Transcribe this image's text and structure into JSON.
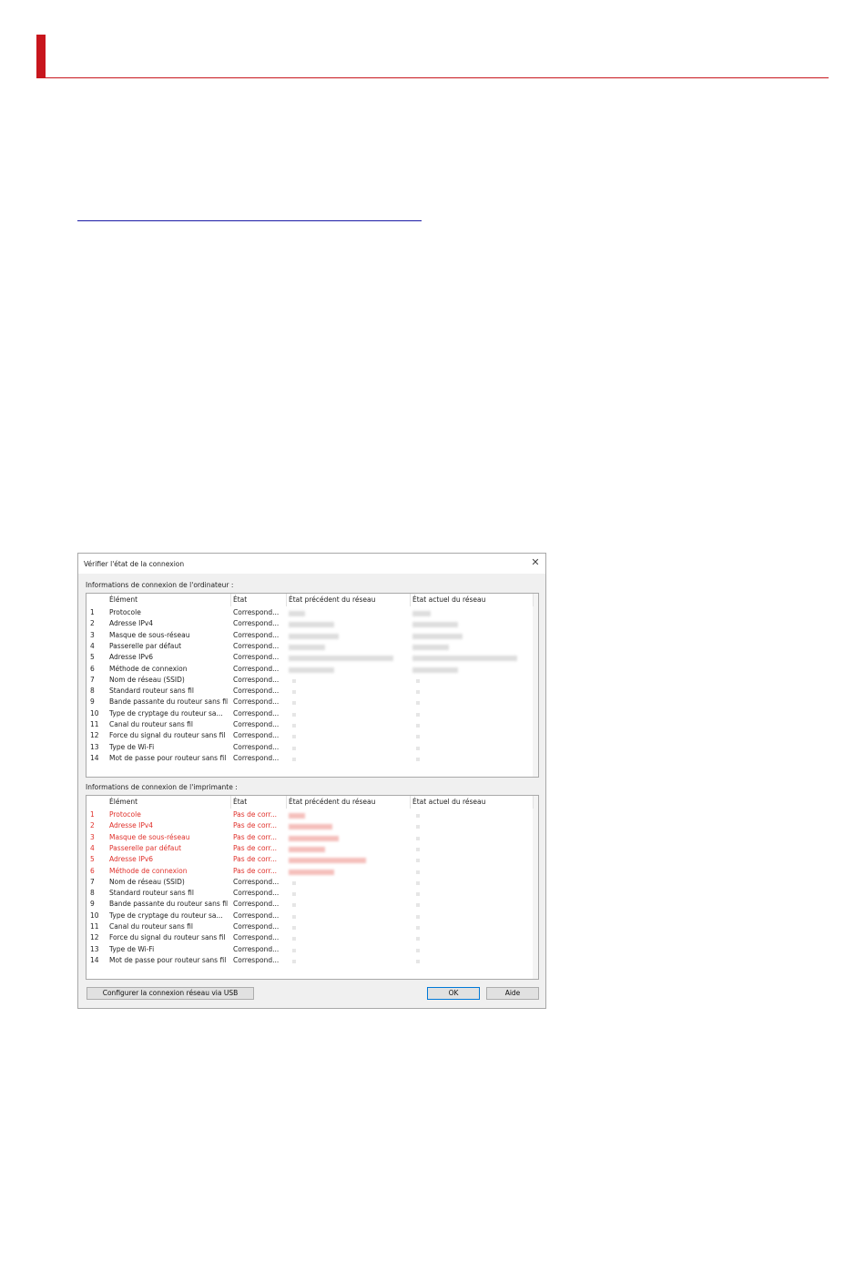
{
  "dialog": {
    "title": "Vérifier l'état de la connexion",
    "computer_section_label": "Informations de connexion de l'ordinateur :",
    "printer_section_label": "Informations de connexion de l'imprimante :",
    "columns": [
      "Élément",
      "État",
      "État précédent du réseau",
      "État actuel du réseau"
    ],
    "computer_rows": [
      {
        "no": "1",
        "item": "Protocole",
        "state": "Correspond..."
      },
      {
        "no": "2",
        "item": "Adresse IPv4",
        "state": "Correspond..."
      },
      {
        "no": "3",
        "item": "Masque de sous-réseau",
        "state": "Correspond..."
      },
      {
        "no": "4",
        "item": "Passerelle par défaut",
        "state": "Correspond..."
      },
      {
        "no": "5",
        "item": "Adresse IPv6",
        "state": "Correspond..."
      },
      {
        "no": "6",
        "item": "Méthode de connexion",
        "state": "Correspond..."
      },
      {
        "no": "7",
        "item": "Nom de réseau (SSID)",
        "state": "Correspond..."
      },
      {
        "no": "8",
        "item": "Standard routeur sans fil",
        "state": "Correspond..."
      },
      {
        "no": "9",
        "item": "Bande passante du routeur sans fil",
        "state": "Correspond..."
      },
      {
        "no": "10",
        "item": "Type de cryptage du routeur sa...",
        "state": "Correspond..."
      },
      {
        "no": "11",
        "item": "Canal du routeur sans fil",
        "state": "Correspond..."
      },
      {
        "no": "12",
        "item": "Force du signal du routeur sans fil",
        "state": "Correspond..."
      },
      {
        "no": "13",
        "item": "Type de Wi-Fi",
        "state": "Correspond..."
      },
      {
        "no": "14",
        "item": "Mot de passe pour routeur sans fil",
        "state": "Correspond..."
      }
    ],
    "printer_rows": [
      {
        "no": "1",
        "item": "Protocole",
        "state": "Pas de corr...",
        "mismatch": true
      },
      {
        "no": "2",
        "item": "Adresse IPv4",
        "state": "Pas de corr...",
        "mismatch": true
      },
      {
        "no": "3",
        "item": "Masque de sous-réseau",
        "state": "Pas de corr...",
        "mismatch": true
      },
      {
        "no": "4",
        "item": "Passerelle par défaut",
        "state": "Pas de corr...",
        "mismatch": true
      },
      {
        "no": "5",
        "item": "Adresse IPv6",
        "state": "Pas de corr...",
        "mismatch": true
      },
      {
        "no": "6",
        "item": "Méthode de connexion",
        "state": "Pas de corr...",
        "mismatch": true
      },
      {
        "no": "7",
        "item": "Nom de réseau (SSID)",
        "state": "Correspond...",
        "mismatch": false
      },
      {
        "no": "8",
        "item": "Standard routeur sans fil",
        "state": "Correspond...",
        "mismatch": false
      },
      {
        "no": "9",
        "item": "Bande passante du routeur sans fil",
        "state": "Correspond...",
        "mismatch": false
      },
      {
        "no": "10",
        "item": "Type de cryptage du routeur sa...",
        "state": "Correspond...",
        "mismatch": false
      },
      {
        "no": "11",
        "item": "Canal du routeur sans fil",
        "state": "Correspond...",
        "mismatch": false
      },
      {
        "no": "12",
        "item": "Force du signal du routeur sans fil",
        "state": "Correspond...",
        "mismatch": false
      },
      {
        "no": "13",
        "item": "Type de Wi-Fi",
        "state": "Correspond...",
        "mismatch": false
      },
      {
        "no": "14",
        "item": "Mot de passe pour routeur sans fil",
        "state": "Correspond...",
        "mismatch": false
      }
    ],
    "buttons": {
      "usb": "Configurer la connexion réseau via USB",
      "ok": "OK",
      "help": "Aide"
    }
  },
  "colors": {
    "accent_red": "#c8161d",
    "mismatch_text": "#e0302a",
    "link_rule": "#1a1aa6"
  }
}
